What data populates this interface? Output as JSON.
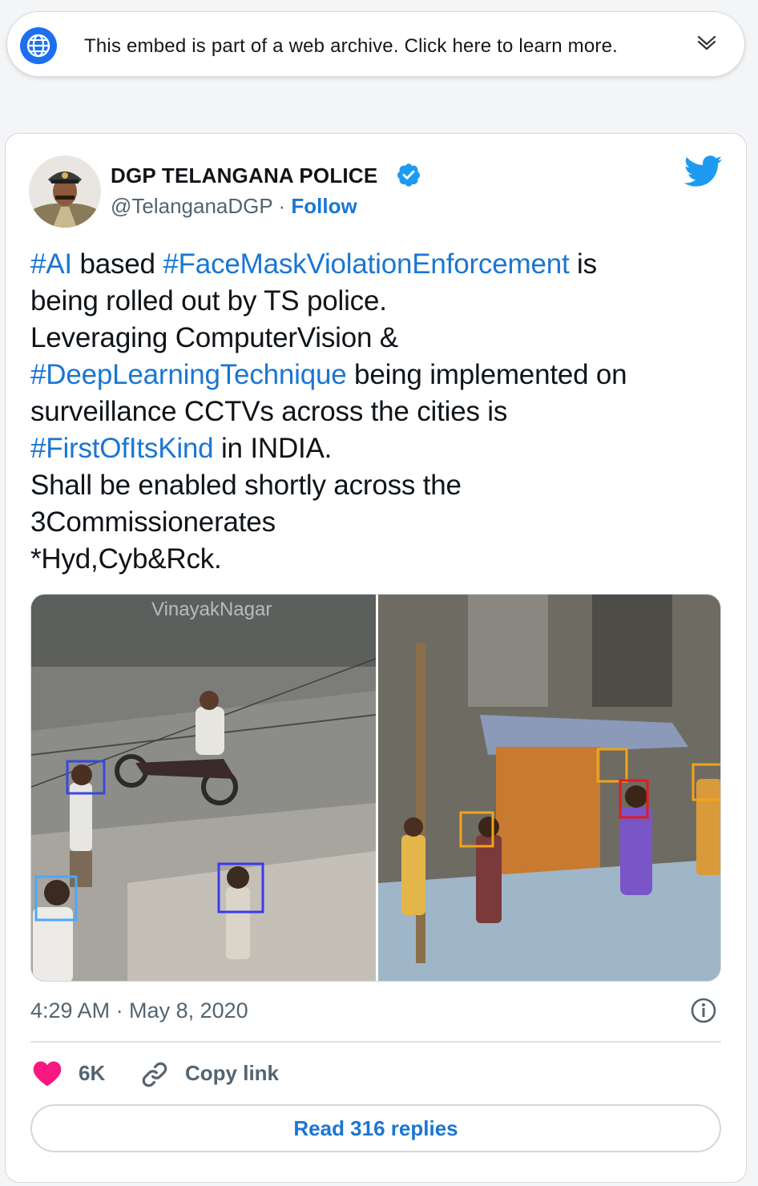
{
  "banner": {
    "text": "This embed is part of a web archive. Click here to learn more.",
    "icon": "globe-icon",
    "toggle_icon": "chevron-down-icon"
  },
  "tweet": {
    "author_name": "DGP TELANGANA POLICE",
    "handle": "@TelanganaDGP",
    "separator": "·",
    "follow_label": "Follow",
    "verified": true,
    "text_lines": [
      [
        {
          "t": "#AI",
          "tag": true
        },
        {
          "t": " based ",
          "tag": false
        },
        {
          "t": "#FaceMaskViolationEnforcement",
          "tag": true
        },
        {
          "t": " is",
          "tag": false
        }
      ],
      [
        {
          "t": "being rolled out by TS police.",
          "tag": false
        }
      ],
      [
        {
          "t": "Leveraging ComputerVision &",
          "tag": false
        }
      ],
      [
        {
          "t": "#DeepLearningTechnique",
          "tag": true
        },
        {
          "t": " being implemented on",
          "tag": false
        }
      ],
      [
        {
          "t": "surveillance CCTVs across the cities is",
          "tag": false
        }
      ],
      [
        {
          "t": "#FirstOfItsKind",
          "tag": true
        },
        {
          "t": " in INDIA.",
          "tag": false
        }
      ],
      [
        {
          "t": "Shall be enabled shortly across the",
          "tag": false
        }
      ],
      [
        {
          "t": "3Commissionerates",
          "tag": false
        }
      ],
      [
        {
          "t": "*Hyd,Cyb&Rck.",
          "tag": false
        }
      ]
    ],
    "media_overlay_text": "VinayakNagar",
    "timestamp": "4:29 AM · May 8, 2020",
    "like_count": "6K",
    "copy_link_label": "Copy link",
    "read_replies_label": "Read 316 replies"
  },
  "colors": {
    "link_blue": "#1b76d2",
    "heart_pink": "#f91880",
    "twitter_blue": "#1d9bf0",
    "secondary_text": "#536471"
  }
}
